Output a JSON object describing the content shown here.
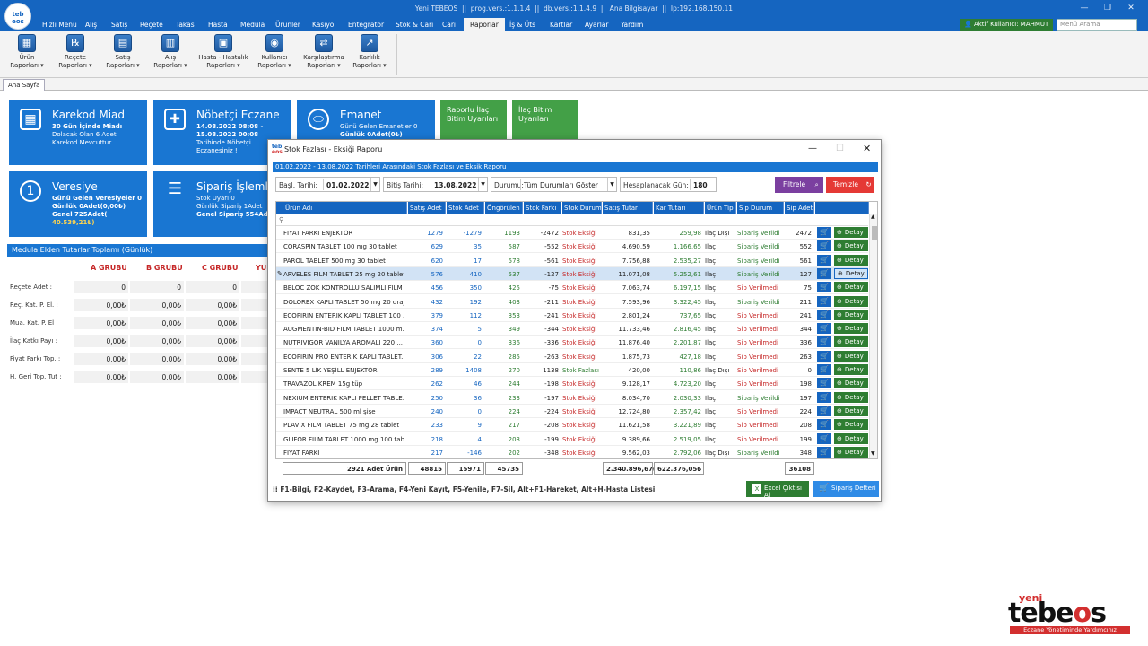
{
  "app": {
    "title_bar": "Yeni TEBEOS  ||  prog.vers.:1.1.1.4  ||  db.vers.:1.1.4.9  ||  Ana Bilgisayar  ||  Ip:192.168.150.11",
    "logo_line1": "teb",
    "logo_line2": "eos",
    "user_label": "Aktif Kullanıcı: MAHMUT",
    "search_placeholder": "Menü Arama"
  },
  "menu": [
    "Hızlı Menü",
    "Alış",
    "Satış",
    "Reçete",
    "Takas",
    "Hasta",
    "Medula",
    "Ürünler",
    "Kasiyol",
    "Entegratör",
    "Stok & Cari",
    "Cari",
    "Raporlar",
    "İş & Üts",
    "Kartlar",
    "Ayarlar",
    "Yardım"
  ],
  "ribbon": [
    {
      "l1": "Ürün",
      "l2": "Raporları ▾",
      "icon": "▦"
    },
    {
      "l1": "Reçete",
      "l2": "Raporları ▾",
      "icon": "℞"
    },
    {
      "l1": "Satış",
      "l2": "Raporları ▾",
      "icon": "▤"
    },
    {
      "l1": "Alış",
      "l2": "Raporları ▾",
      "icon": "▥"
    },
    {
      "l1": "Hasta - Hastalık",
      "l2": "Raporları ▾",
      "icon": "▣"
    },
    {
      "l1": "Kullanıcı",
      "l2": "Raporları ▾",
      "icon": "◉"
    },
    {
      "l1": "Karşılaştırma",
      "l2": "Raporları ▾",
      "icon": "⇄"
    },
    {
      "l1": "Karlılık",
      "l2": "Raporları ▾",
      "icon": "↗"
    }
  ],
  "tabs": {
    "home": "Ana Sayfa"
  },
  "tiles": {
    "karekod": {
      "title": "Karekod Miad",
      "l1": "30 Gün İçinde Miadı",
      "l2": "Dolacak Olan 6 Adet",
      "l3": "Karekod Mevcuttur"
    },
    "nobetci": {
      "title": "Nöbetçi Eczane",
      "l1": "14.08.2022 08:08 -",
      "l2": "15.08.2022 00:08",
      "l3": "Tarihinde Nöbetçi",
      "l4": "Eczanesiniz !"
    },
    "emanet": {
      "title": "Emanet",
      "l1": "Günü Gelen Emanetler 0",
      "l2": "Günlük 0Adet(0₺)"
    },
    "raporlu": {
      "l1": "Raporlu İlaç",
      "l2": "Bitim Uyarıları"
    },
    "ilacbitim": {
      "l1": "İlaç Bitim",
      "l2": "Uyarıları"
    },
    "veresiye": {
      "title": "Veresiye",
      "l1": "Günü Gelen Veresiyeler 0",
      "l2": "Günlük 0Adet(0,00₺)",
      "l3": "Genel 725Adet(",
      "l4": "40.539,21₺)"
    },
    "siparis": {
      "title": "Sipariş İşlemle",
      "l1": "Stok Uyarı 0",
      "l2": "Günlük Sipariş 1Adet",
      "l3": "Genel Sipariş 554Adet"
    }
  },
  "medula": {
    "header": "Medula Elden Tutarlar Toplamı (Günlük)",
    "groups": [
      "A GRUBU",
      "B GRUBU",
      "C GRUBU",
      "YUI"
    ],
    "rows": [
      {
        "label": "Reçete Adet :",
        "vals": [
          "0",
          "0",
          "0"
        ]
      },
      {
        "label": "Reç. Kat. P. El. :",
        "vals": [
          "0,00₺",
          "0,00₺",
          "0,00₺"
        ]
      },
      {
        "label": "Mua. Kat. P. El :",
        "vals": [
          "0,00₺",
          "0,00₺",
          "0,00₺"
        ]
      },
      {
        "label": "İlaç Katkı Payı :",
        "vals": [
          "0,00₺",
          "0,00₺",
          "0,00₺"
        ]
      },
      {
        "label": "Fiyat Farkı Top. :",
        "vals": [
          "0,00₺",
          "0,00₺",
          "0,00₺"
        ]
      },
      {
        "label": "H. Geri Top. Tut :",
        "vals": [
          "0,00₺",
          "0,00₺",
          "0,00₺"
        ]
      }
    ]
  },
  "dialog": {
    "title": "Stok Fazlası - Eksiği Raporu",
    "info": "01.02.2022 - 13.08.2022 Tarihleri Arasındaki Stok Fazlası ve Eksik Raporu",
    "filters": {
      "start_label": "Başl. Tarihi:",
      "start_val": "01.02.2022",
      "end_label": "Bitiş Tarihi:",
      "end_val": "13.08.2022",
      "status_label": "Durumu:",
      "status_val": "Tüm Durumları Göster",
      "days_label": "Hesaplanacak Gün:",
      "days_val": "180"
    },
    "btn_filter": "Filtrele",
    "btn_clear": "Temizle",
    "columns": [
      "Ürün Adı",
      "Satış Adet",
      "Stok Adet",
      "Öngörülen",
      "Stok Farkı",
      "Stok Durum",
      "Satış Tutar",
      "Kar Tutarı",
      "Ürün Tip",
      "Sip Durum",
      "Sip Adet"
    ],
    "detay_label": "Detay",
    "rows": [
      {
        "name": "FIYAT FARKI ENJEKTÖR",
        "satis": "1279",
        "stok": "-1279",
        "ong": "1193",
        "fark": "-2472",
        "sd": "Stok Eksiği",
        "tutar": "831,35",
        "kar": "259,98",
        "tip": "İlaç Dışı",
        "sip": "Sipariş Verildi",
        "sipadet": "2472"
      },
      {
        "name": "CORASPIN TABLET 100 mg 30 tablet",
        "satis": "629",
        "stok": "35",
        "ong": "587",
        "fark": "-552",
        "sd": "Stok Eksiği",
        "tutar": "4.690,59",
        "kar": "1.166,65",
        "tip": "İlaç",
        "sip": "Sipariş Verildi",
        "sipadet": "552"
      },
      {
        "name": "PAROL TABLET 500 mg 30 tablet",
        "satis": "620",
        "stok": "17",
        "ong": "578",
        "fark": "-561",
        "sd": "Stok Eksiği",
        "tutar": "7.756,88",
        "kar": "2.535,27",
        "tip": "İlaç",
        "sip": "Sipariş Verildi",
        "sipadet": "561"
      },
      {
        "name": "ARVELES FILM TABLET 25 mg 20 tablet",
        "satis": "576",
        "stok": "410",
        "ong": "537",
        "fark": "-127",
        "sd": "Stok Eksiği",
        "tutar": "11.071,08",
        "kar": "5.252,61",
        "tip": "İlaç",
        "sip": "Sipariş Verildi",
        "sipadet": "127",
        "selected": true
      },
      {
        "name": "BELOC ZOK KONTROLLU SALIMLI FILM ...",
        "satis": "456",
        "stok": "350",
        "ong": "425",
        "fark": "-75",
        "sd": "Stok Eksiği",
        "tutar": "7.063,74",
        "kar": "6.197,15",
        "tip": "İlaç",
        "sip": "Sip Verilmedi",
        "sipadet": "75"
      },
      {
        "name": "DOLOREX KAPLI TABLET 50 mg 20 draje",
        "satis": "432",
        "stok": "192",
        "ong": "403",
        "fark": "-211",
        "sd": "Stok Eksiği",
        "tutar": "7.593,96",
        "kar": "3.322,45",
        "tip": "İlaç",
        "sip": "Sipariş Verildi",
        "sipadet": "211"
      },
      {
        "name": "ECOPIRIN ENTERIK KAPLI TABLET 100 ...",
        "satis": "379",
        "stok": "112",
        "ong": "353",
        "fark": "-241",
        "sd": "Stok Eksiği",
        "tutar": "2.801,24",
        "kar": "737,65",
        "tip": "İlaç",
        "sip": "Sip Verilmedi",
        "sipadet": "241"
      },
      {
        "name": "AUGMENTIN-BID FILM TABLET 1000 m...",
        "satis": "374",
        "stok": "5",
        "ong": "349",
        "fark": "-344",
        "sd": "Stok Eksiği",
        "tutar": "11.733,46",
        "kar": "2.816,45",
        "tip": "İlaç",
        "sip": "Sip Verilmedi",
        "sipadet": "344"
      },
      {
        "name": "NUTRIVIGOR VANILYA AROMALI  220 ...",
        "satis": "360",
        "stok": "0",
        "ong": "336",
        "fark": "-336",
        "sd": "Stok Eksiği",
        "tutar": "11.876,40",
        "kar": "2.201,87",
        "tip": "İlaç",
        "sip": "Sip Verilmedi",
        "sipadet": "336"
      },
      {
        "name": "ECOPIRIN PRO ENTERIK KAPLI TABLET...",
        "satis": "306",
        "stok": "22",
        "ong": "285",
        "fark": "-263",
        "sd": "Stok Eksiği",
        "tutar": "1.875,73",
        "kar": "427,18",
        "tip": "İlaç",
        "sip": "Sip Verilmedi",
        "sipadet": "263"
      },
      {
        "name": "SENTE 5 LİK YEŞİLL ENJEKTÖR",
        "satis": "289",
        "stok": "1408",
        "ong": "270",
        "fark": "1138",
        "sd": "Stok Fazlası",
        "tutar": "420,00",
        "kar": "110,86",
        "tip": "İlaç Dışı",
        "sip": "Sip Verilmedi",
        "sipadet": "0"
      },
      {
        "name": "TRAVAZOL KREM  15g tüp",
        "satis": "262",
        "stok": "46",
        "ong": "244",
        "fark": "-198",
        "sd": "Stok Eksiği",
        "tutar": "9.128,17",
        "kar": "4.723,20",
        "tip": "İlaç",
        "sip": "Sip Verilmedi",
        "sipadet": "198"
      },
      {
        "name": "NEXIUM ENTERIK KAPLI PELLET TABLE...",
        "satis": "250",
        "stok": "36",
        "ong": "233",
        "fark": "-197",
        "sd": "Stok Eksiği",
        "tutar": "8.034,70",
        "kar": "2.030,33",
        "tip": "İlaç",
        "sip": "Sipariş Verildi",
        "sipadet": "197"
      },
      {
        "name": "IMPACT NEUTRAL  500 ml şişe",
        "satis": "240",
        "stok": "0",
        "ong": "224",
        "fark": "-224",
        "sd": "Stok Eksiği",
        "tutar": "12.724,80",
        "kar": "2.357,42",
        "tip": "İlaç",
        "sip": "Sip Verilmedi",
        "sipadet": "224"
      },
      {
        "name": "PLAVIX FILM TABLET 75 mg 28 tablet",
        "satis": "233",
        "stok": "9",
        "ong": "217",
        "fark": "-208",
        "sd": "Stok Eksiği",
        "tutar": "11.621,58",
        "kar": "3.221,89",
        "tip": "İlaç",
        "sip": "Sip Verilmedi",
        "sipadet": "208"
      },
      {
        "name": "GLIFOR FILM TABLET 1000 mg 100 tablet",
        "satis": "218",
        "stok": "4",
        "ong": "203",
        "fark": "-199",
        "sd": "Stok Eksiği",
        "tutar": "9.389,66",
        "kar": "2.519,05",
        "tip": "İlaç",
        "sip": "Sip Verilmedi",
        "sipadet": "199"
      },
      {
        "name": "FIYAT FARKI",
        "satis": "217",
        "stok": "-146",
        "ong": "202",
        "fark": "-348",
        "sd": "Stok Eksiği",
        "tutar": "9.562,03",
        "kar": "2.792,06",
        "tip": "İlaç Dışı",
        "sip": "Sipariş Verildi",
        "sipadet": "348"
      }
    ],
    "totals": {
      "count": "2921 Adet Ürün",
      "satis": "48815",
      "stok": "15971",
      "ong": "45735",
      "tutar": "2.340.896,67₺",
      "kar": "622.376,05₺",
      "sipadet": "36108"
    },
    "hotkeys": "F1-Bilgi, F2-Kaydet, F3-Arama, F4-Yeni Kayıt, F5-Yenile, F7-Sil, Alt+F1-Hareket, Alt+H-Hasta Listesi",
    "btn_excel": "Excel Çıktısı Al",
    "btn_siparis": "Sipariş Defteri"
  },
  "brand": {
    "top": "yeni",
    "word_a": "tebe",
    "word_b": "o",
    "word_c": "s",
    "slogan": "Eczane Yönetiminde Yardımcınız"
  },
  "colors": {
    "primary": "#1565c0",
    "tile_blue": "#1976d2",
    "tile_green": "#43a047",
    "danger": "#e53935",
    "filter_purple": "#7b3fa0",
    "ok_green": "#2e7d32"
  }
}
